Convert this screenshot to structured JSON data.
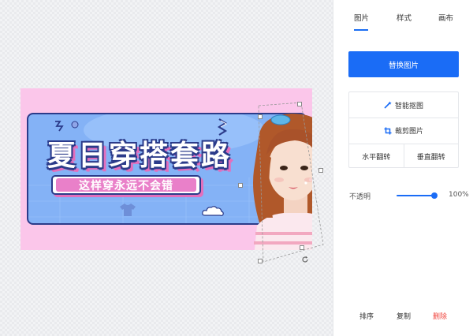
{
  "canvas": {
    "banner": {
      "title": "夏日穿搭套路",
      "subtitle": "这样穿永远不会错",
      "colors": {
        "background": "#fbc6ea",
        "panel": "#84b2f6",
        "outline": "#2b3b8a",
        "accent": "#e36fbc"
      }
    },
    "selection": {
      "rotate_icon": "rotate-handle-icon"
    }
  },
  "panel": {
    "tabs": [
      {
        "label": "图片",
        "active": true
      },
      {
        "label": "样式",
        "active": false
      },
      {
        "label": "画布",
        "active": false
      }
    ],
    "replace_button": "替换图片",
    "tools": {
      "smart_cutout": {
        "label": "智能抠图",
        "icon": "magic-wand-icon"
      },
      "crop": {
        "label": "裁剪图片",
        "icon": "crop-icon"
      },
      "flip_horizontal": "水平翻转",
      "flip_vertical": "垂直翻转"
    },
    "opacity": {
      "label": "不透明",
      "value_text": "100%",
      "value": 1.0
    },
    "actions": {
      "order": "排序",
      "copy": "复制",
      "delete": "删除"
    },
    "colors": {
      "primary": "#1a6cf6",
      "danger": "#f0443d"
    }
  }
}
